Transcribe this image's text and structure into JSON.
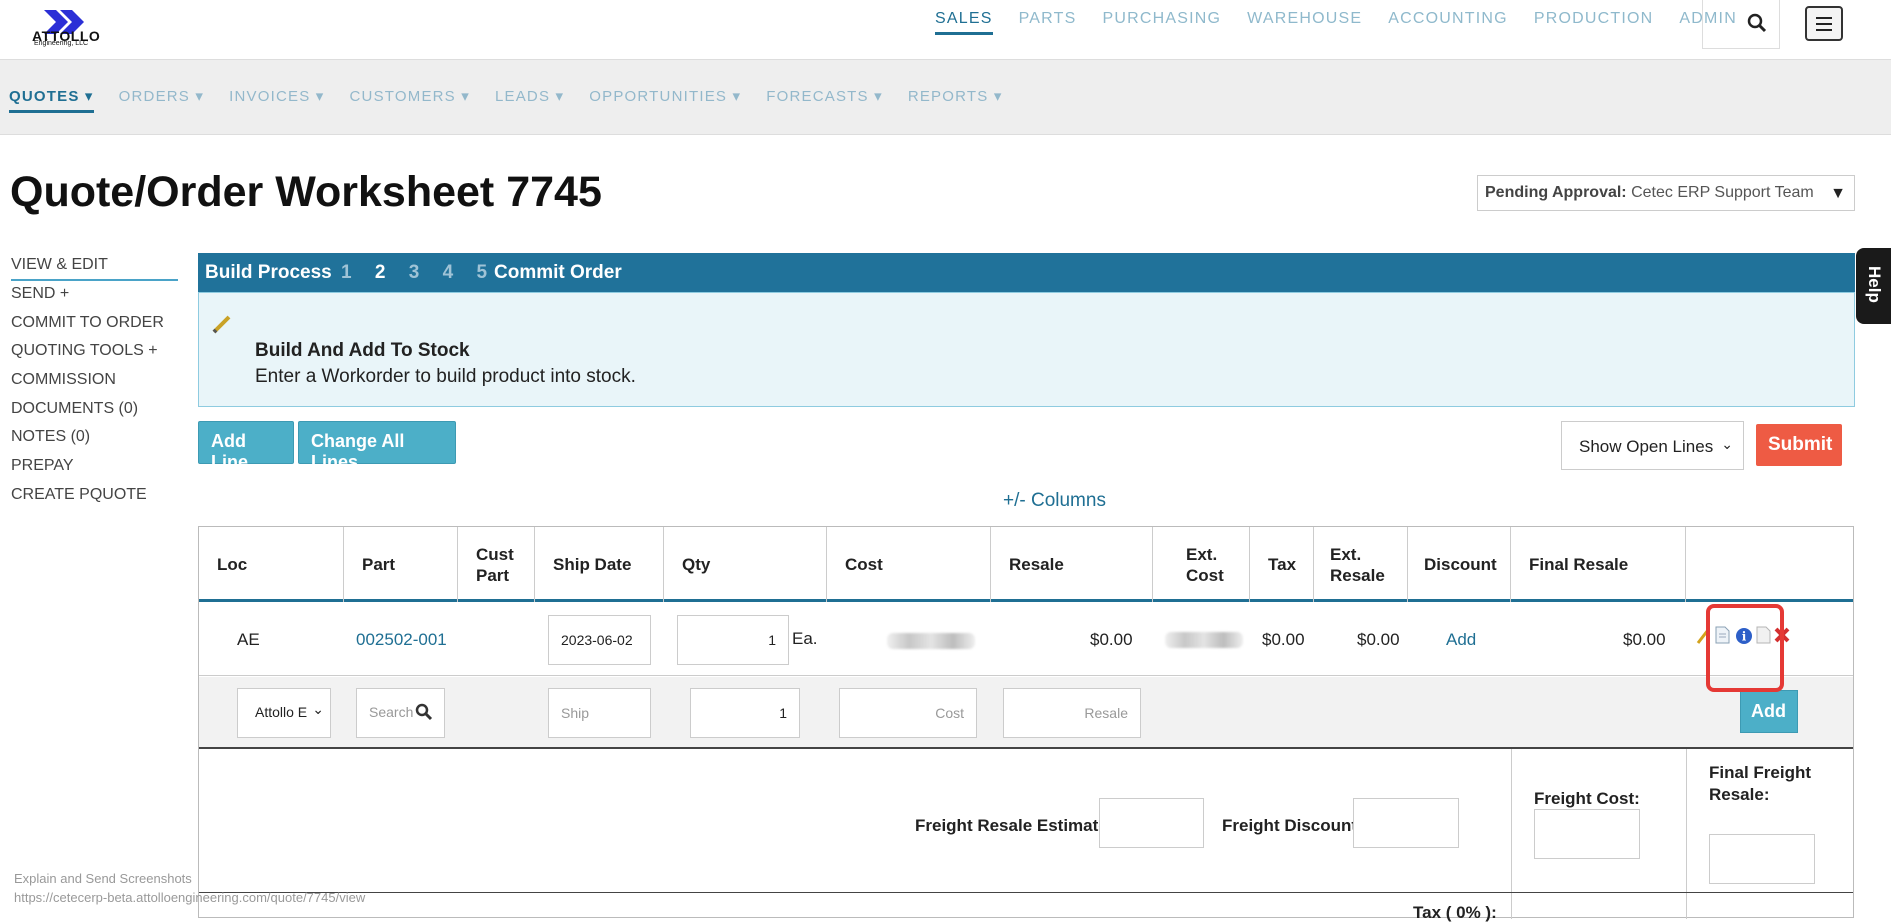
{
  "brand": {
    "name": "ATTOLLO",
    "sub": "Engineering, LLC"
  },
  "main_nav": [
    "SALES",
    "PARTS",
    "PURCHASING",
    "WAREHOUSE",
    "ACCOUNTING",
    "PRODUCTION",
    "ADMIN"
  ],
  "sub_nav": [
    "QUOTES ▾",
    "ORDERS ▾",
    "INVOICES ▾",
    "CUSTOMERS ▾",
    "LEADS ▾",
    "OPPORTUNITIES ▾",
    "FORECASTS ▾",
    "REPORTS ▾"
  ],
  "page": {
    "title": "Quote/Order Worksheet 7745",
    "approval_label": "Pending Approval:",
    "approval_value": "Cetec ERP Support Team",
    "help": "Help"
  },
  "side_menu": [
    "VIEW & EDIT",
    "SEND +",
    "COMMIT TO ORDER",
    "QUOTING TOOLS +",
    "COMMISSION",
    "DOCUMENTS (0)",
    "NOTES (0)",
    "PREPAY",
    "CREATE PQUOTE"
  ],
  "build": {
    "label": "Build Process",
    "steps": [
      "1",
      "2",
      "3",
      "4",
      "5"
    ],
    "current_step": "2",
    "commit": "Commit Order",
    "heading": "Build And Add To Stock",
    "description": "Enter a Workorder to build product into stock."
  },
  "actions": {
    "add_line": "Add Line",
    "change_all": "Change All Lines",
    "show_lines": "Show Open Lines",
    "submit": "Submit",
    "columns": "+/- Columns"
  },
  "table": {
    "headers": [
      "Loc",
      "Part",
      "Cust\nPart",
      "Ship Date",
      "Qty",
      "Cost",
      "Resale",
      "Ext.\nCost",
      "Tax",
      "Ext.\nResale",
      "Discount",
      "Final Resale"
    ],
    "row": {
      "loc": "AE",
      "part": "002502-001",
      "ship_date": "2023-06-02",
      "qty": "1",
      "unit": "Ea.",
      "resale": "$0.00",
      "tax": "$0.00",
      "ext_resale": "$0.00",
      "discount": "Add",
      "final_resale": "$0.00"
    },
    "entry": {
      "location": "Attollo E",
      "part_placeholder": "Search",
      "ship_placeholder": "Ship",
      "qty": "1",
      "cost_placeholder": "Cost",
      "resale_placeholder": "Resale",
      "add": "Add"
    }
  },
  "footer": {
    "freight_resale": "Freight Resale Estimate:",
    "freight_discount": "Freight Discount:",
    "freight_cost": "Freight Cost:",
    "final_freight": "Final Freight Resale:",
    "tax": "Tax ( 0% ):"
  },
  "status": {
    "line1": "Explain and Send Screenshots",
    "line2": "https://cetecerp-beta.attolloengineering.com/quote/7745/view"
  }
}
